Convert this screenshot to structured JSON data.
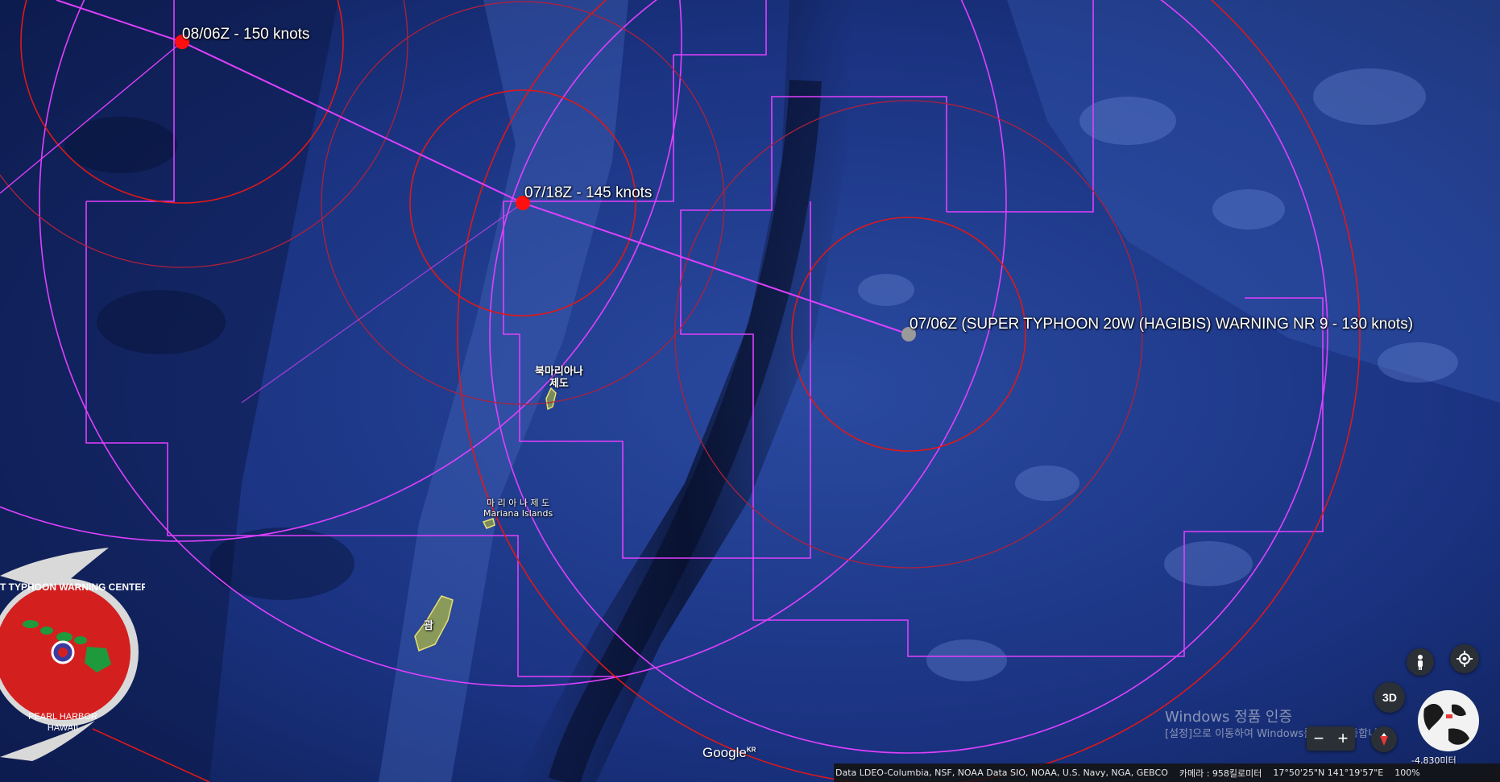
{
  "labels": {
    "forecast_1": "08/06Z - 150 knots",
    "forecast_2": "07/18Z - 145 knots",
    "current": "07/06Z (SUPER TYPHOON 20W (HAGIBIS) WARNING NR 9    - 130 knots)"
  },
  "places": {
    "north_mariana": [
      "북마리아나",
      "제도"
    ],
    "mariana_kr": "마 리 아 나  제 도",
    "mariana_en": "Mariana Islands",
    "guam": "괌"
  },
  "logo": {
    "arc_text": "JOINT TYPHOON WARNING CENTER",
    "line1": "PEARL HARBOR",
    "line2": "HAWAII"
  },
  "controls": {
    "three_d": "3D",
    "zoom_out": "−",
    "zoom_in": "+",
    "scale": "-4,830미터"
  },
  "watermark": {
    "title": "Windows 정품 인증",
    "subtitle": "[설정]으로 이동하여 Windows를 정품 인증합니다."
  },
  "status_bar": {
    "attribution": "Data LDEO-Columbia, NSF, NOAA Data SIO, NOAA, U.S. Navy, NGA, GEBCO",
    "camera": "카메라 :  958킬로미터",
    "coordinates": "17°50'25\"N 141°19'57\"E",
    "zoom": "100%"
  },
  "brand": {
    "google": "Google",
    "region": "KR"
  },
  "colors": {
    "ocean": "#1a3580",
    "track": "#e040ff",
    "radius_red": "#e01818",
    "radius_dark": "#b0203c",
    "storm_point": "#ff1010",
    "current_point": "#9a9a9a"
  }
}
